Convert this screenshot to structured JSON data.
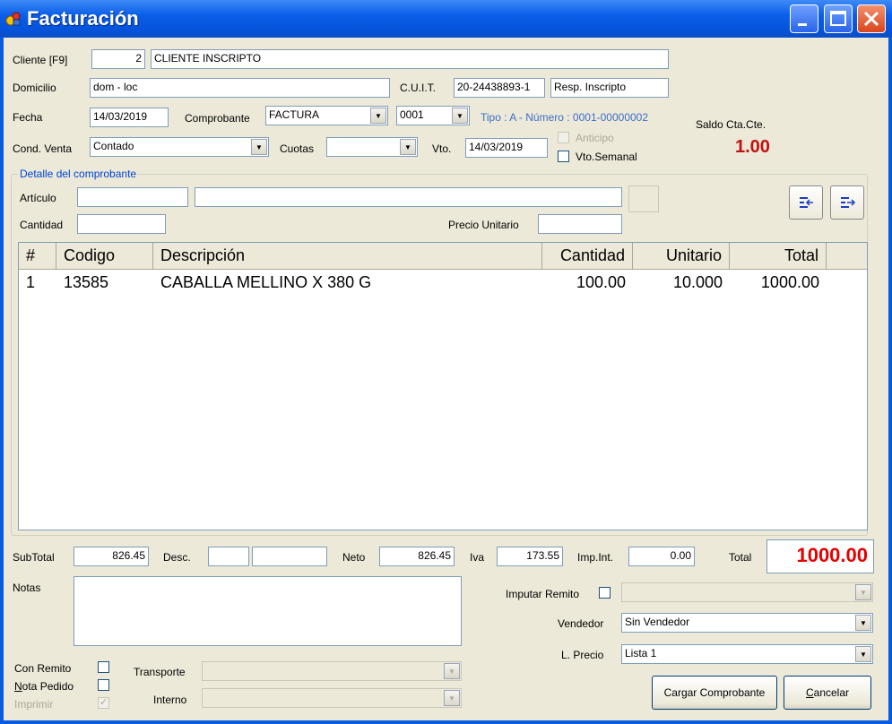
{
  "window": {
    "title": "Facturación"
  },
  "header": {
    "cliente_label": "Cliente [F9]",
    "cliente_code": "2",
    "cliente_name": "CLIENTE INSCRIPTO",
    "domicilio_label": "Domicilio",
    "domicilio": "dom - loc",
    "cuit_label": "C.U.I.T.",
    "cuit": "20-24438893-1",
    "iva_cond": "Resp. Inscripto",
    "fecha_label": "Fecha",
    "fecha": "14/03/2019",
    "comprobante_label": "Comprobante",
    "comprobante": "FACTURA",
    "punto_venta": "0001",
    "tipo_numero": "Tipo : A - Número : 0001-00000002",
    "saldo_label": "Saldo Cta.Cte.",
    "saldo": "1.00",
    "cond_venta_label": "Cond. Venta",
    "cond_venta": "Contado",
    "cuotas_label": "Cuotas",
    "cuotas": "",
    "vto_label": "Vto.",
    "vto": "14/03/2019",
    "anticipo_label": "Anticipo",
    "vto_semanal_label": "Vto.Semanal"
  },
  "detalle": {
    "group_title": "Detalle del comprobante",
    "articulo_label": "Artículo",
    "cantidad_label": "Cantidad",
    "precio_label": "Precio Unitario",
    "articulo_code": "",
    "articulo_desc": "",
    "cantidad": "",
    "precio": ""
  },
  "grid": {
    "columns": [
      "#",
      "Codigo",
      "Descripción",
      "Cantidad",
      "Unitario",
      "Total"
    ],
    "rows": [
      [
        "1",
        "13585",
        "CABALLA  MELLINO X 380 G",
        "100.00",
        "10.000",
        "1000.00"
      ]
    ]
  },
  "totals": {
    "subtotal_label": "SubTotal",
    "subtotal": "826.45",
    "desc_label": "Desc.",
    "desc1": "",
    "desc2": "",
    "neto_label": "Neto",
    "neto": "826.45",
    "iva_label": "Iva",
    "iva": "173.55",
    "impint_label": "Imp.Int.",
    "impint": "0.00",
    "total_label": "Total",
    "total": "1000.00"
  },
  "footer": {
    "notas_label": "Notas",
    "notas": "",
    "imputar_label": "Imputar Remito",
    "vendedor_label": "Vendedor",
    "vendedor": "Sin Vendedor",
    "lprecio_label": "L. Precio",
    "lprecio": "Lista 1",
    "con_remito_label": "Con Remito",
    "nota_pedido_first": "N",
    "nota_pedido_rest": "ota Pedido",
    "imprimir_label": "Imprimir",
    "transporte_label": "Transporte",
    "interno_label": "Interno",
    "cargar_label": "Cargar Comprobante",
    "cancelar_first": "C",
    "cancelar_rest": "ancelar"
  },
  "colors": {
    "titlebar": "#0553d9",
    "accent_red": "#e50000",
    "link_blue": "#3c6fc8"
  }
}
